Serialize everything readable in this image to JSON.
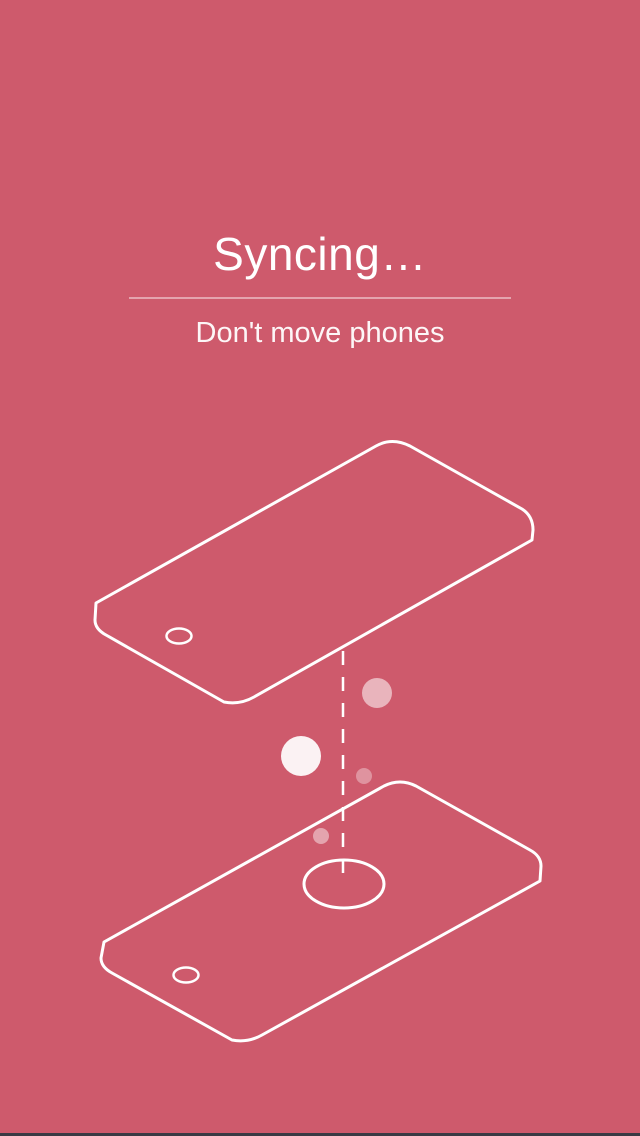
{
  "screen": {
    "title": "Syncing…",
    "subtitle": "Don't move phones"
  },
  "colors": {
    "background": "#ce5a6c",
    "foreground": "#ffffff"
  },
  "illustration": {
    "top_phone_icon": "phone-outline-icon",
    "bottom_phone_icon": "phone-outline-icon",
    "sync_particles_icon": "sync-particles-icon"
  }
}
